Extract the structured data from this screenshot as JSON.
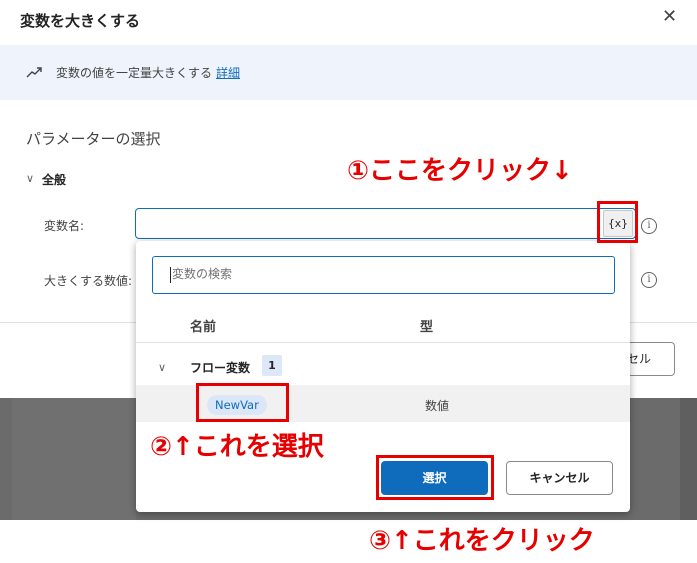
{
  "dialog": {
    "title": "変数を大きくする",
    "close_icon": "close-icon",
    "info_text": "変数の値を一定量大きくする",
    "info_link": "詳細",
    "param_heading": "パラメーターの選択",
    "section_general": "全般",
    "var_name_label": "変数名:",
    "var_picker_label": "{x}",
    "amount_label": "大きくする数値:",
    "behind_cancel_label": "セル"
  },
  "popup": {
    "search_placeholder": "変数の検索",
    "col_name": "名前",
    "col_type": "型",
    "group_label": "フロー変数",
    "group_count": "1",
    "variables": [
      {
        "name": "NewVar",
        "type": "数値"
      }
    ],
    "select_label": "選択",
    "cancel_label": "キャンセル"
  },
  "annotations": {
    "step1": "①ここをクリック↓",
    "step2": "②↑これを選択",
    "step3": "③↑これをクリック",
    "color": "#e60000"
  },
  "colors": {
    "accent": "#0f6cbd",
    "info_bar": "#eef3fc",
    "backdrop": "#6b6b6b"
  }
}
